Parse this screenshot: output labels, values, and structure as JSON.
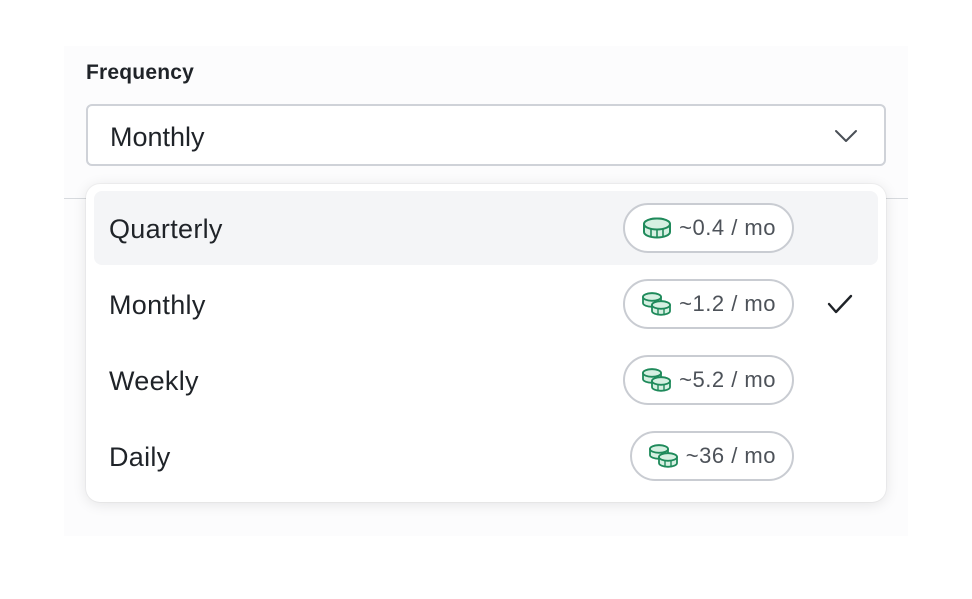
{
  "field": {
    "label": "Frequency",
    "selected_value": "Monthly"
  },
  "options": [
    {
      "label": "Quarterly",
      "rate": "~0.4 / mo",
      "icon": "single-coin-icon",
      "highlighted": true,
      "selected": false
    },
    {
      "label": "Monthly",
      "rate": "~1.2 / mo",
      "icon": "coins-stack-icon",
      "highlighted": false,
      "selected": true
    },
    {
      "label": "Weekly",
      "rate": "~5.2 / mo",
      "icon": "coins-stack-icon",
      "highlighted": false,
      "selected": false
    },
    {
      "label": "Daily",
      "rate": "~36 / mo",
      "icon": "coins-stack-icon",
      "highlighted": false,
      "selected": false
    }
  ],
  "colors": {
    "coin": "#1f8a5b",
    "coin_fill": "#d6f0e2",
    "highlight": "#f4f5f7",
    "border": "#cfd2d8"
  }
}
